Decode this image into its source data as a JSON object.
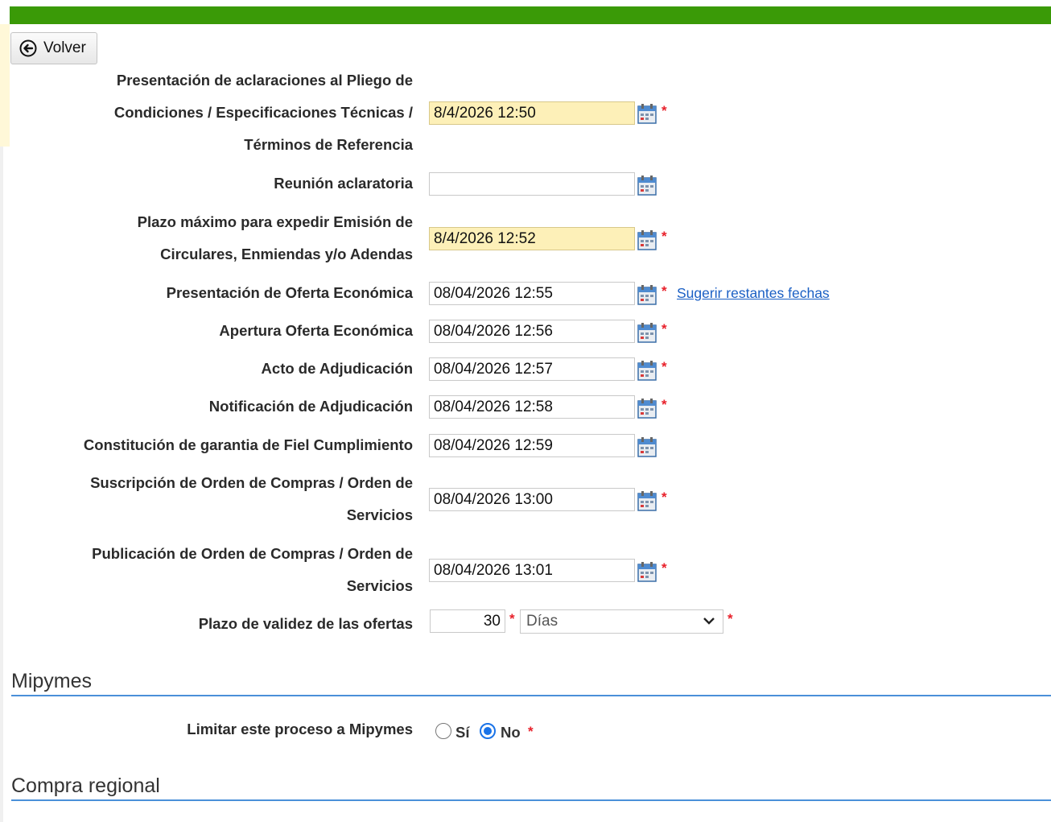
{
  "back_label": "Volver",
  "fields": [
    {
      "lines": [
        "Presentación de aclaraciones al Pliego de",
        "Condiciones / Especificaciones Técnicas /",
        "Términos de Referencia"
      ],
      "value": "8/4/2026 12:50",
      "required": true
    },
    {
      "lines": [
        "Reunión aclaratoria"
      ],
      "value": "",
      "required": false
    },
    {
      "lines": [
        "Plazo máximo para expedir Emisión de",
        "Circulares, Enmiendas y/o Adendas"
      ],
      "value": "8/4/2026 12:52",
      "required": true
    },
    {
      "lines": [
        "Presentación de Oferta Económica"
      ],
      "value": "08/04/2026 12:55",
      "required": true
    },
    {
      "lines": [
        "Apertura Oferta Económica"
      ],
      "value": "08/04/2026 12:56",
      "required": true
    },
    {
      "lines": [
        "Acto de Adjudicación"
      ],
      "value": "08/04/2026 12:57",
      "required": true
    },
    {
      "lines": [
        "Notificación de Adjudicación"
      ],
      "value": "08/04/2026 12:58",
      "required": true
    },
    {
      "lines": [
        "Constitución de garantia de Fiel Cumplimiento"
      ],
      "value": "08/04/2026 12:59",
      "required": false
    },
    {
      "lines": [
        "Suscripción de Orden de Compras / Orden de",
        "Servicios"
      ],
      "value": "08/04/2026 13:00",
      "required": true
    },
    {
      "lines": [
        "Publicación de Orden de Compras / Orden de",
        "Servicios"
      ],
      "value": "08/04/2026 13:01",
      "required": true
    }
  ],
  "suggest_link": "Sugerir restantes fechas",
  "validity": {
    "label": "Plazo de validez de las ofertas",
    "number": "30",
    "unit": "Días"
  },
  "required_mark": "*",
  "mipymes": {
    "title": "Mipymes",
    "label": "Limitar este proceso a Mipymes",
    "options": [
      "Sí",
      "No"
    ],
    "selected": "No"
  },
  "regional": {
    "title": "Compra regional"
  },
  "colors": {
    "header_green": "#3a9a07",
    "required_bg": "#fdf0b8",
    "link": "#1a5fc4",
    "section_line": "#4a90d9"
  }
}
